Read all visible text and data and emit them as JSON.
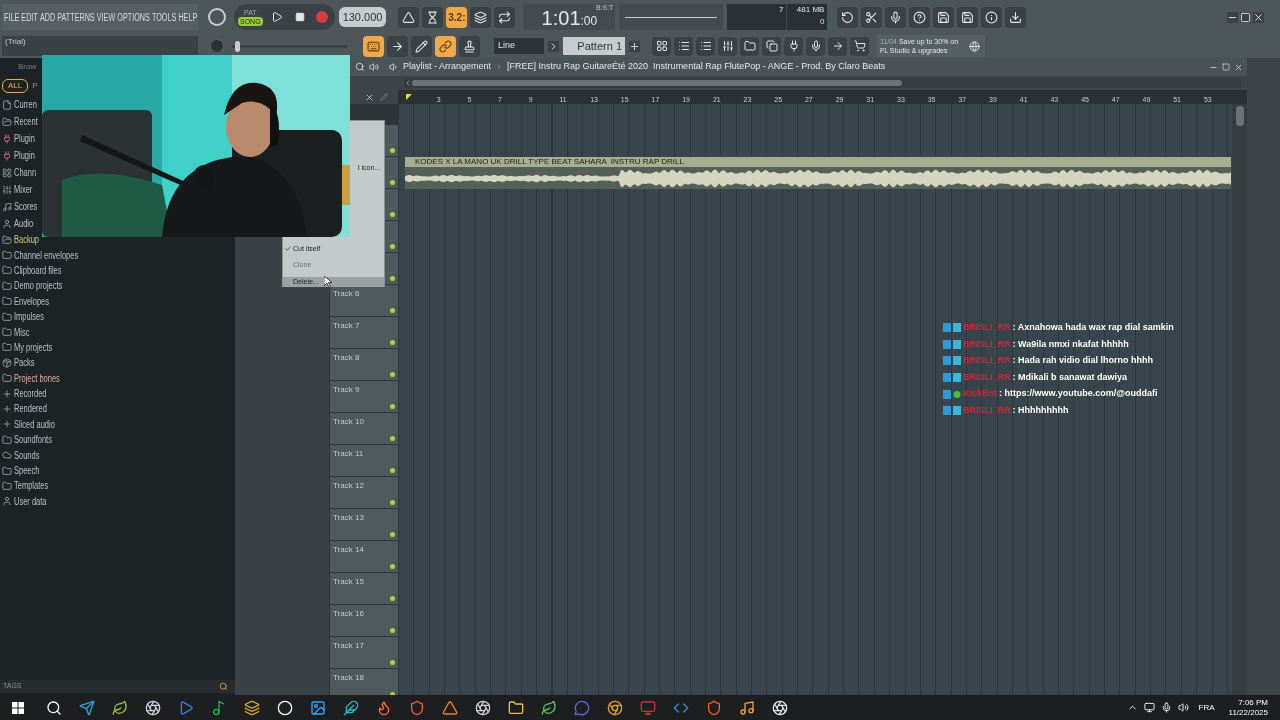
{
  "menu": [
    "FILE",
    "EDIT",
    "ADD",
    "PATTERNS",
    "VIEW",
    "OPTIONS",
    "TOOLS",
    "HELP"
  ],
  "hint_bar": "(Trial)",
  "pitch": {
    "level": 0.03
  },
  "transport": {
    "modes": [
      {
        "label": "PAT",
        "selected": false
      },
      {
        "label": "SONG",
        "selected": true
      }
    ],
    "recording": false,
    "tempo": "130.000"
  },
  "toggles": [
    {
      "kind": "metronome",
      "on": false
    },
    {
      "kind": "wait",
      "on": false
    },
    {
      "kind": "countdown",
      "label": "3.2:",
      "on": true
    },
    {
      "kind": "blend",
      "on": false
    },
    {
      "kind": "loop",
      "on": false
    }
  ],
  "time": {
    "main": "1:01",
    "ticks": ":00",
    "format": "B:S:T"
  },
  "monitor": {
    "cpu": "7",
    "memory": "481 MB",
    "polyphony": "0"
  },
  "tools": [
    {
      "kind": "typing",
      "on": true
    },
    {
      "kind": "step",
      "on": false
    },
    {
      "kind": "draw",
      "on": false
    },
    {
      "kind": "link",
      "on": true
    },
    {
      "kind": "stamp",
      "on": false
    }
  ],
  "snap": "Line",
  "pattern": "Pattern 1",
  "news": {
    "date": "11/04",
    "lines": [
      "Save up to 30% on",
      "FL Studio & upgrades"
    ]
  },
  "browser": {
    "title": "Brow",
    "tabs": [
      {
        "label": "ALL",
        "selected": true
      },
      {
        "label": "P",
        "selected": false
      }
    ],
    "items": [
      {
        "label": "Curren",
        "kind": "file"
      },
      {
        "label": "Recent",
        "kind": "recent"
      },
      {
        "label": "Plugin",
        "kind": "plugin"
      },
      {
        "label": "Plugin",
        "kind": "plugin"
      },
      {
        "label": "Chann",
        "kind": "channel"
      },
      {
        "label": "Mixer",
        "kind": "mixer"
      },
      {
        "label": "Scores",
        "kind": "score"
      },
      {
        "label": "Audio",
        "kind": "user"
      },
      {
        "label": "Backup",
        "kind": "backup"
      },
      {
        "label": "Channel envelopes",
        "kind": "folder"
      },
      {
        "label": "Clipboard files",
        "kind": "folder"
      },
      {
        "label": "Demo projects",
        "kind": "folder"
      },
      {
        "label": "Envelopes",
        "kind": "folder"
      },
      {
        "label": "Impulses",
        "kind": "folder"
      },
      {
        "label": "Misc",
        "kind": "folder"
      },
      {
        "label": "My projects",
        "kind": "folder"
      },
      {
        "label": "Packs",
        "kind": "packs"
      },
      {
        "label": "Project bones",
        "kind": "bones"
      },
      {
        "label": "Recorded",
        "kind": "audio"
      },
      {
        "label": "Rendered",
        "kind": "audio"
      },
      {
        "label": "Sliced audio",
        "kind": "audio"
      },
      {
        "label": "Soundfonts",
        "kind": "folder"
      },
      {
        "label": "Sounds",
        "kind": "cloud"
      },
      {
        "label": "Speech",
        "kind": "folder"
      },
      {
        "label": "Templates",
        "kind": "folder"
      },
      {
        "label": "User data",
        "kind": "user"
      }
    ],
    "tags_label": "TAGS"
  },
  "playlist": {
    "title": "Playlist - Arrangement",
    "project": "[FREE] Instru Rap GuitareÉté 2020  Instrumental Rap FlutePop - ANGE - Prod. By Claro Beats",
    "ruler": [
      "3",
      "5",
      "7",
      "9",
      "11",
      "13",
      "15",
      "17",
      "19",
      "21",
      "23",
      "25",
      "27",
      "29",
      "31",
      "33",
      "35",
      "37",
      "39",
      "41",
      "43",
      "45",
      "47",
      "49",
      "51",
      "53"
    ],
    "clip": {
      "name": "KODES X LA MANO UK DRILL TYPE BEAT SAHARA  INSTRU RAP DRILL"
    },
    "tracks": [
      {
        "label": "Track 6"
      },
      {
        "label": "Track 7"
      },
      {
        "label": "Track 8"
      },
      {
        "label": "Track 9"
      },
      {
        "label": "Track 10"
      },
      {
        "label": "Track 11"
      },
      {
        "label": "Track 12"
      },
      {
        "label": "Track 13"
      },
      {
        "label": "Track 14"
      },
      {
        "label": "Track 15"
      },
      {
        "label": "Track 16"
      },
      {
        "label": "Track 17"
      },
      {
        "label": "Track 18"
      }
    ]
  },
  "context_menu": [
    {
      "label": "l icon...",
      "kind": "clipped",
      "checked": false,
      "disabled": false,
      "selected": false
    },
    {
      "label": "Cut itself",
      "kind": "item",
      "checked": true,
      "disabled": false,
      "selected": false
    },
    {
      "label": "Clone",
      "kind": "item",
      "checked": false,
      "disabled": true,
      "selected": false
    },
    {
      "label": "Delete...",
      "kind": "item",
      "checked": false,
      "disabled": false,
      "selected": true
    }
  ],
  "chat": [
    {
      "user": "BRISLI_RR",
      "kind": "user",
      "text": ": Axnahowa hada wax rap dial samkin"
    },
    {
      "user": "BRISLI_RR",
      "kind": "user",
      "text": ": Wa9ila nmxi nkafat hhhhh"
    },
    {
      "user": "BRISLI_RR",
      "kind": "user",
      "text": ": Hada rah vidio dial lhorno hhhh"
    },
    {
      "user": "BRISLI_RR",
      "kind": "user",
      "text": ": Mdikali b sanawat dawiya"
    },
    {
      "user": "KickBot",
      "kind": "bot",
      "text": ": https://www.youtube.com/@ouddafi"
    },
    {
      "user": "BRISLI_RR",
      "kind": "user",
      "text": ": Hhhhhhhhh"
    }
  ],
  "tray": {
    "language": "FRA",
    "time": "7:06 PM",
    "date": "11/22/2025"
  }
}
